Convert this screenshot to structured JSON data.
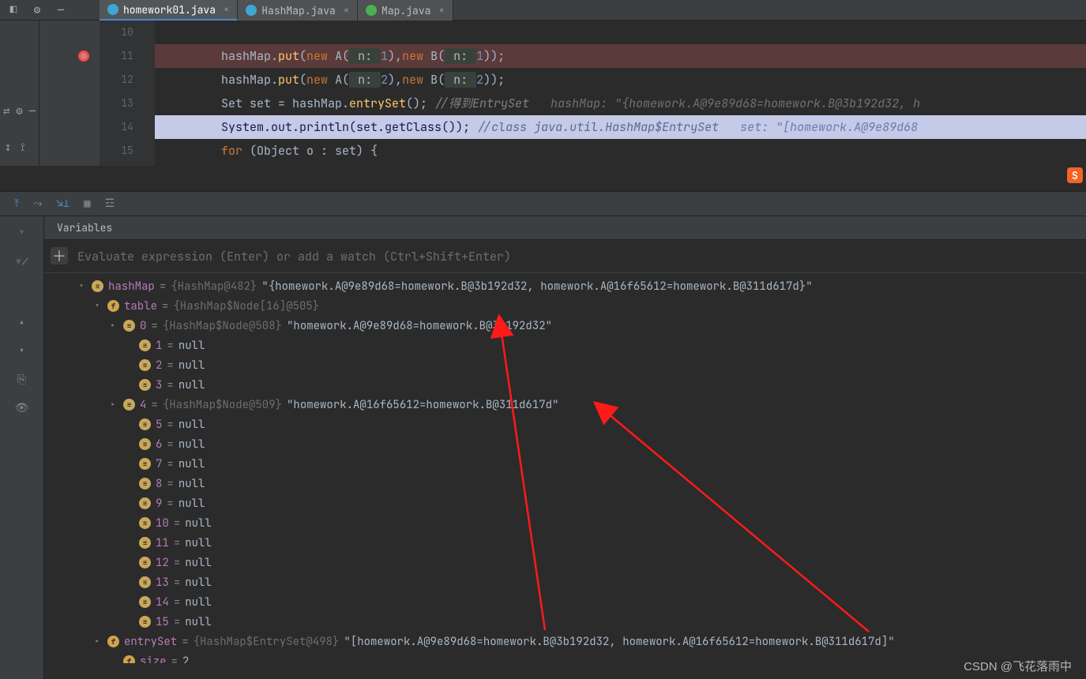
{
  "tabs": [
    {
      "label": "homework01.java",
      "icon": "#3fa6d4",
      "active": true
    },
    {
      "label": "HashMap.java",
      "icon": "#3fa6d4",
      "active": false
    },
    {
      "label": "Map.java",
      "icon": "#4caf50",
      "active": false
    }
  ],
  "code": {
    "lines": [
      {
        "no": "10",
        "html": ""
      },
      {
        "no": "11",
        "bp": true,
        "html": "        hashMap.<span class='fn'>put</span>(<span class='kw'>new</span> A(<span class='param'> n: </span><span class='num'>1</span>),<span class='kw'>new</span> B(<span class='param'> n: </span><span class='num'>1</span>));"
      },
      {
        "no": "12",
        "html": "        hashMap.<span class='fn'>put</span>(<span class='kw'>new</span> A(<span class='param'> n: </span><span class='num'>2</span>),<span class='kw'>new</span> B(<span class='param'> n: </span><span class='num'>2</span>));"
      },
      {
        "no": "13",
        "html": "        Set set = hashMap.<span class='fn'>entrySet</span>(); <span class='cmt'>//得到EntrySet</span>   <span class='hint'>hashMap: \"{homework.A@9e89d68=homework.B@3b192d32, h</span>"
      },
      {
        "no": "14",
        "exec": true,
        "html": "        System.out.<span class='fn'>println</span>(set.<span class='fn'>getClass</span>()); <span class='cmt'>//class java.util.HashMap$EntrySet</span>   <span class='hint'>set: \"[homework.A@9e89d68</span>"
      },
      {
        "no": "15",
        "html": "        <span class='kw'>for</span> (Object o : set) {"
      }
    ]
  },
  "debug": {
    "vars_title": "Variables",
    "eval_placeholder": "Evaluate expression (Enter) or add a watch (Ctrl+Shift+Enter)",
    "tree": [
      {
        "indent": 40,
        "chev": "▾",
        "ic": "arr",
        "key": "hashMap",
        "type": "{HashMap@482}",
        "val": "\"{homework.A@9e89d68=homework.B@3b192d32, homework.A@16f65612=homework.B@311d617d}\""
      },
      {
        "indent": 60,
        "chev": "▾",
        "ic": "fld",
        "key": "table",
        "type": "{HashMap$Node[16]@505}",
        "val": ""
      },
      {
        "indent": 80,
        "chev": "▸",
        "ic": "arr",
        "key": "0",
        "type": "{HashMap$Node@508}",
        "val": "\"homework.A@9e89d68=homework.B@3b192d32\""
      },
      {
        "indent": 100,
        "chev": "",
        "ic": "arr",
        "key": "1",
        "type": "",
        "val": "null"
      },
      {
        "indent": 100,
        "chev": "",
        "ic": "arr",
        "key": "2",
        "type": "",
        "val": "null"
      },
      {
        "indent": 100,
        "chev": "",
        "ic": "arr",
        "key": "3",
        "type": "",
        "val": "null"
      },
      {
        "indent": 80,
        "chev": "▸",
        "ic": "arr",
        "key": "4",
        "type": "{HashMap$Node@509}",
        "val": "\"homework.A@16f65612=homework.B@311d617d\""
      },
      {
        "indent": 100,
        "chev": "",
        "ic": "arr",
        "key": "5",
        "type": "",
        "val": "null"
      },
      {
        "indent": 100,
        "chev": "",
        "ic": "arr",
        "key": "6",
        "type": "",
        "val": "null"
      },
      {
        "indent": 100,
        "chev": "",
        "ic": "arr",
        "key": "7",
        "type": "",
        "val": "null"
      },
      {
        "indent": 100,
        "chev": "",
        "ic": "arr",
        "key": "8",
        "type": "",
        "val": "null"
      },
      {
        "indent": 100,
        "chev": "",
        "ic": "arr",
        "key": "9",
        "type": "",
        "val": "null"
      },
      {
        "indent": 100,
        "chev": "",
        "ic": "arr",
        "key": "10",
        "type": "",
        "val": "null"
      },
      {
        "indent": 100,
        "chev": "",
        "ic": "arr",
        "key": "11",
        "type": "",
        "val": "null"
      },
      {
        "indent": 100,
        "chev": "",
        "ic": "arr",
        "key": "12",
        "type": "",
        "val": "null"
      },
      {
        "indent": 100,
        "chev": "",
        "ic": "arr",
        "key": "13",
        "type": "",
        "val": "null"
      },
      {
        "indent": 100,
        "chev": "",
        "ic": "arr",
        "key": "14",
        "type": "",
        "val": "null"
      },
      {
        "indent": 100,
        "chev": "",
        "ic": "arr",
        "key": "15",
        "type": "",
        "val": "null"
      },
      {
        "indent": 60,
        "chev": "▸",
        "ic": "fld",
        "key": "entrySet",
        "type": "{HashMap$EntrySet@498}",
        "val": "\"[homework.A@9e89d68=homework.B@3b192d32, homework.A@16f65612=homework.B@311d617d]\""
      },
      {
        "indent": 80,
        "chev": "",
        "ic": "fld",
        "key": "size",
        "type": "",
        "val": "2"
      }
    ]
  },
  "watermark": "CSDN @飞花落雨中",
  "sl_badge": "S"
}
